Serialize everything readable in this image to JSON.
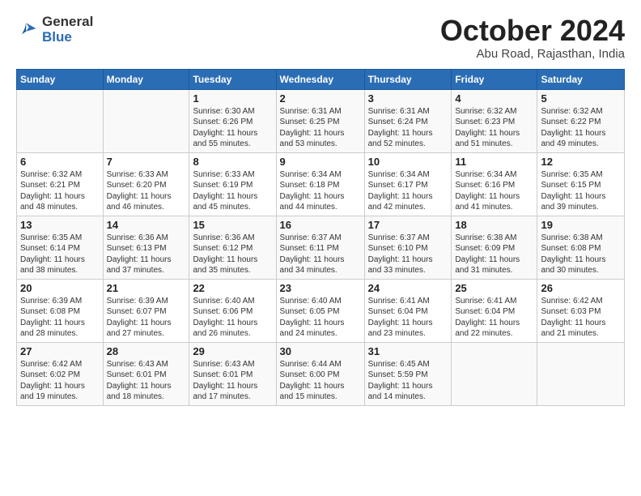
{
  "logo": {
    "line1": "General",
    "line2": "Blue"
  },
  "title": "October 2024",
  "subtitle": "Abu Road, Rajasthan, India",
  "headers": [
    "Sunday",
    "Monday",
    "Tuesday",
    "Wednesday",
    "Thursday",
    "Friday",
    "Saturday"
  ],
  "weeks": [
    [
      {
        "day": "",
        "info": ""
      },
      {
        "day": "",
        "info": ""
      },
      {
        "day": "1",
        "info": "Sunrise: 6:30 AM\nSunset: 6:26 PM\nDaylight: 11 hours\nand 55 minutes."
      },
      {
        "day": "2",
        "info": "Sunrise: 6:31 AM\nSunset: 6:25 PM\nDaylight: 11 hours\nand 53 minutes."
      },
      {
        "day": "3",
        "info": "Sunrise: 6:31 AM\nSunset: 6:24 PM\nDaylight: 11 hours\nand 52 minutes."
      },
      {
        "day": "4",
        "info": "Sunrise: 6:32 AM\nSunset: 6:23 PM\nDaylight: 11 hours\nand 51 minutes."
      },
      {
        "day": "5",
        "info": "Sunrise: 6:32 AM\nSunset: 6:22 PM\nDaylight: 11 hours\nand 49 minutes."
      }
    ],
    [
      {
        "day": "6",
        "info": "Sunrise: 6:32 AM\nSunset: 6:21 PM\nDaylight: 11 hours\nand 48 minutes."
      },
      {
        "day": "7",
        "info": "Sunrise: 6:33 AM\nSunset: 6:20 PM\nDaylight: 11 hours\nand 46 minutes."
      },
      {
        "day": "8",
        "info": "Sunrise: 6:33 AM\nSunset: 6:19 PM\nDaylight: 11 hours\nand 45 minutes."
      },
      {
        "day": "9",
        "info": "Sunrise: 6:34 AM\nSunset: 6:18 PM\nDaylight: 11 hours\nand 44 minutes."
      },
      {
        "day": "10",
        "info": "Sunrise: 6:34 AM\nSunset: 6:17 PM\nDaylight: 11 hours\nand 42 minutes."
      },
      {
        "day": "11",
        "info": "Sunrise: 6:34 AM\nSunset: 6:16 PM\nDaylight: 11 hours\nand 41 minutes."
      },
      {
        "day": "12",
        "info": "Sunrise: 6:35 AM\nSunset: 6:15 PM\nDaylight: 11 hours\nand 39 minutes."
      }
    ],
    [
      {
        "day": "13",
        "info": "Sunrise: 6:35 AM\nSunset: 6:14 PM\nDaylight: 11 hours\nand 38 minutes."
      },
      {
        "day": "14",
        "info": "Sunrise: 6:36 AM\nSunset: 6:13 PM\nDaylight: 11 hours\nand 37 minutes."
      },
      {
        "day": "15",
        "info": "Sunrise: 6:36 AM\nSunset: 6:12 PM\nDaylight: 11 hours\nand 35 minutes."
      },
      {
        "day": "16",
        "info": "Sunrise: 6:37 AM\nSunset: 6:11 PM\nDaylight: 11 hours\nand 34 minutes."
      },
      {
        "day": "17",
        "info": "Sunrise: 6:37 AM\nSunset: 6:10 PM\nDaylight: 11 hours\nand 33 minutes."
      },
      {
        "day": "18",
        "info": "Sunrise: 6:38 AM\nSunset: 6:09 PM\nDaylight: 11 hours\nand 31 minutes."
      },
      {
        "day": "19",
        "info": "Sunrise: 6:38 AM\nSunset: 6:08 PM\nDaylight: 11 hours\nand 30 minutes."
      }
    ],
    [
      {
        "day": "20",
        "info": "Sunrise: 6:39 AM\nSunset: 6:08 PM\nDaylight: 11 hours\nand 28 minutes."
      },
      {
        "day": "21",
        "info": "Sunrise: 6:39 AM\nSunset: 6:07 PM\nDaylight: 11 hours\nand 27 minutes."
      },
      {
        "day": "22",
        "info": "Sunrise: 6:40 AM\nSunset: 6:06 PM\nDaylight: 11 hours\nand 26 minutes."
      },
      {
        "day": "23",
        "info": "Sunrise: 6:40 AM\nSunset: 6:05 PM\nDaylight: 11 hours\nand 24 minutes."
      },
      {
        "day": "24",
        "info": "Sunrise: 6:41 AM\nSunset: 6:04 PM\nDaylight: 11 hours\nand 23 minutes."
      },
      {
        "day": "25",
        "info": "Sunrise: 6:41 AM\nSunset: 6:04 PM\nDaylight: 11 hours\nand 22 minutes."
      },
      {
        "day": "26",
        "info": "Sunrise: 6:42 AM\nSunset: 6:03 PM\nDaylight: 11 hours\nand 21 minutes."
      }
    ],
    [
      {
        "day": "27",
        "info": "Sunrise: 6:42 AM\nSunset: 6:02 PM\nDaylight: 11 hours\nand 19 minutes."
      },
      {
        "day": "28",
        "info": "Sunrise: 6:43 AM\nSunset: 6:01 PM\nDaylight: 11 hours\nand 18 minutes."
      },
      {
        "day": "29",
        "info": "Sunrise: 6:43 AM\nSunset: 6:01 PM\nDaylight: 11 hours\nand 17 minutes."
      },
      {
        "day": "30",
        "info": "Sunrise: 6:44 AM\nSunset: 6:00 PM\nDaylight: 11 hours\nand 15 minutes."
      },
      {
        "day": "31",
        "info": "Sunrise: 6:45 AM\nSunset: 5:59 PM\nDaylight: 11 hours\nand 14 minutes."
      },
      {
        "day": "",
        "info": ""
      },
      {
        "day": "",
        "info": ""
      }
    ]
  ]
}
